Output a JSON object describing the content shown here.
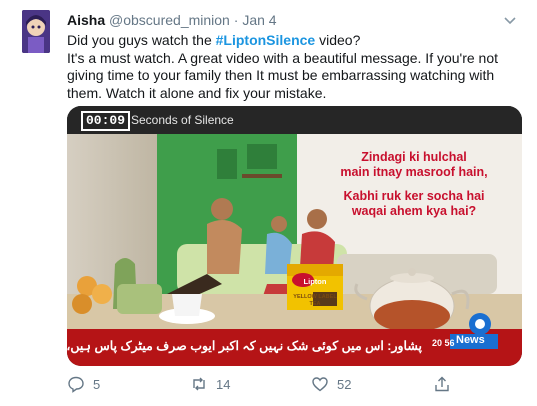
{
  "tweet": {
    "author_name": "Aisha",
    "author_handle": "@obscured_minion",
    "separator": "·",
    "date": "Jan 4",
    "text_line1_pre": "Did you guys watch the ",
    "hashtag": "#LiptonSilence",
    "text_line1_post": " video?",
    "text_body": "It's a must watch. A great video with a beautiful message. If you're not giving time to your family then It must be embarrassing watching with them. Watch it alone and fix your mistake."
  },
  "media": {
    "timer": "00:09",
    "timer_label": "Seconds of Silence",
    "overlay_line1": "Zindagi ki hulchal",
    "overlay_line2": "main itnay masroof hain,",
    "overlay_line3": "Kabhi ruk ker socha hai",
    "overlay_line4": "waqai ahem kya hai?",
    "product_brand": "Lipton",
    "product_label": "YELLOW LABEL",
    "product_sub": "TEA",
    "ticker_text": "پشاور: اس میں کوئی شک نہیں کہ اکبر ایوب صرف میٹرک پاس ہیں، شوکت یوسفزئی",
    "channel_name": "News",
    "channel_time": "20 56"
  },
  "actions": {
    "replies": "5",
    "retweets": "14",
    "likes": "52"
  },
  "colors": {
    "hashtag": "#1b95e0",
    "ticker_bg": "#b51416",
    "overlay_text": "#c8102e",
    "muted": "#657786"
  }
}
